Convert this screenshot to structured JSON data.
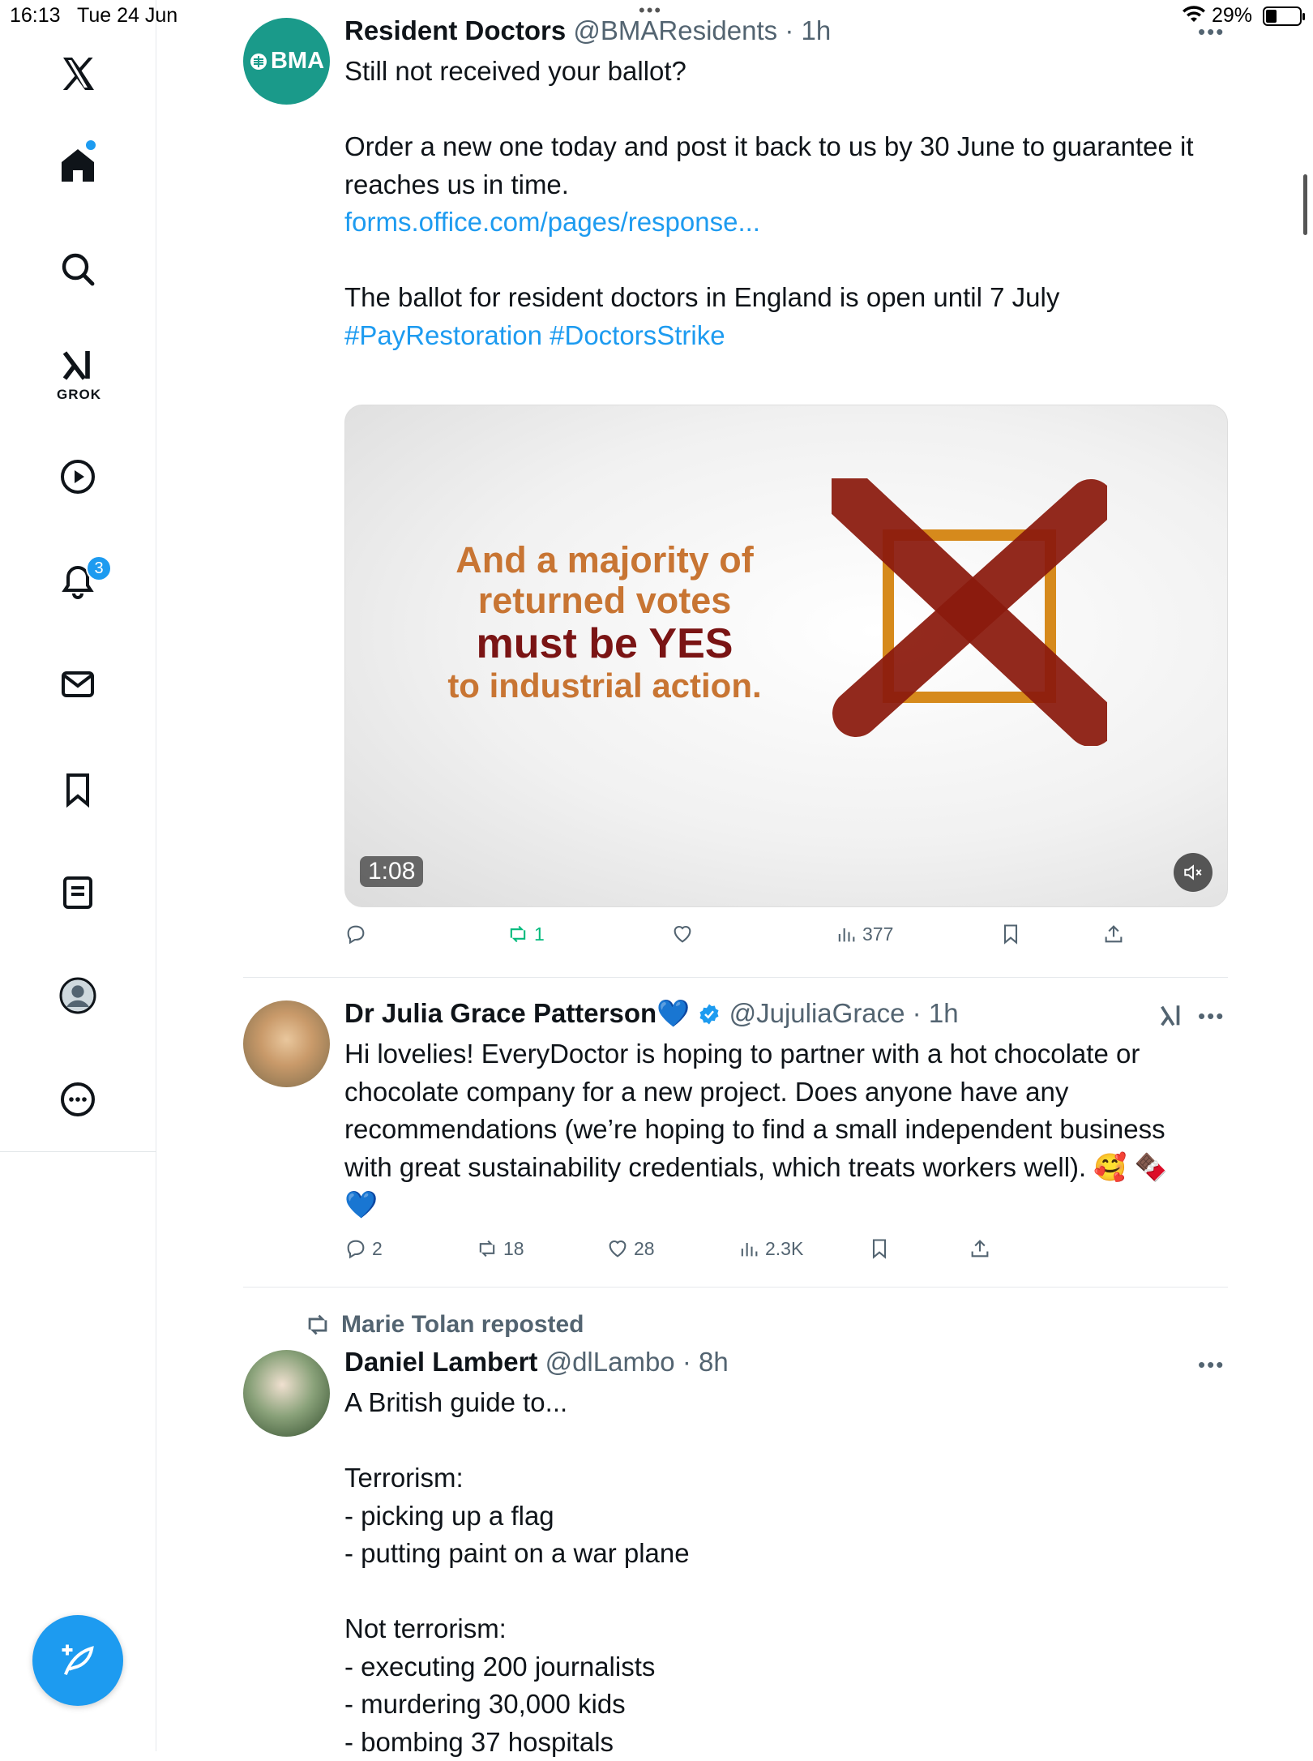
{
  "status_bar": {
    "time": "16:13",
    "date": "Tue 24 Jun",
    "battery": "29%"
  },
  "sidebar": {
    "items": [
      {
        "name": "x-logo"
      },
      {
        "name": "home",
        "dot": true
      },
      {
        "name": "explore"
      },
      {
        "name": "grok",
        "label": "GROK"
      },
      {
        "name": "videos"
      },
      {
        "name": "notifications",
        "badge": "3"
      },
      {
        "name": "messages"
      },
      {
        "name": "bookmarks"
      },
      {
        "name": "lists"
      },
      {
        "name": "profile"
      },
      {
        "name": "more"
      }
    ]
  },
  "tweets": [
    {
      "avatar_text": "BMA",
      "display_name": "Resident Doctors",
      "meta": "@BMAResidents · 1h",
      "body_before_link": "Still not received your ballot?\n\nOrder a new one today and post it back to us by 30 June to guarantee it\nreaches us in time.\n",
      "link": "forms.office.com/pages/response...",
      "body_after_link": "\nThe ballot for resident doctors in England is open until 7 July",
      "hashtags": "#PayRestoration #DoctorsStrike",
      "media": {
        "line1": "And a majority of",
        "line2": "returned votes",
        "line3": "must be YES",
        "line4": "to industrial action.",
        "duration": "1:08"
      },
      "actions": {
        "replies": "",
        "reposts": "1",
        "likes": "",
        "views": "377"
      }
    },
    {
      "display_name": "Dr Julia Grace Patterson💙",
      "meta": "@JujuliaGrace · 1h",
      "body": "Hi lovelies! EveryDoctor is hoping to partner with a hot chocolate or\nchocolate company for a new project. Does anyone have any\nrecommendations (we’re hoping to find a small independent business\nwith great sustainability credentials, which treats workers well). 🥰 🍫\n💙",
      "actions": {
        "replies": "2",
        "reposts": "18",
        "likes": "28",
        "views": "2.3K"
      }
    },
    {
      "repost_by": "Marie Tolan reposted",
      "display_name": "Daniel Lambert",
      "meta": "@dlLambo · 8h",
      "body": "A British guide to...\n\nTerrorism:\n- picking up a flag\n- putting paint on a war plane\n\nNot terrorism:\n- executing 200 journalists\n- murdering 30,000 kids\n- bombing 37 hospitals"
    }
  ],
  "colors": {
    "accent": "#1d9bf0",
    "repost_green": "#00ba7c",
    "muted": "#536471"
  }
}
